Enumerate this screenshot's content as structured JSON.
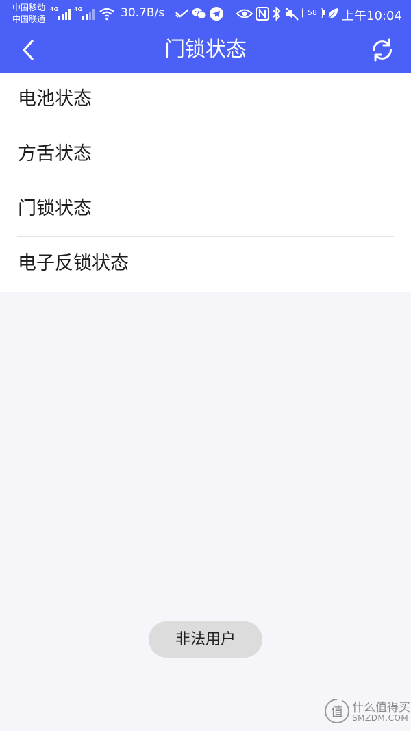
{
  "status_bar": {
    "carrier_1": "中国移动",
    "carrier_2": "中国联通",
    "network_1": "4G",
    "network_2": "4G",
    "net_speed": "30.7B/s",
    "battery": "58",
    "time": "上午10:04",
    "icons": [
      "signal-icon",
      "wifi-icon",
      "check-icon",
      "wechat-icon",
      "telegram-icon",
      "eye-icon",
      "nfc-icon",
      "bluetooth-icon",
      "mute-icon",
      "battery-icon",
      "leaf-icon"
    ]
  },
  "header": {
    "title": "门锁状态",
    "back_icon": "back-arrow-icon",
    "refresh_icon": "refresh-icon"
  },
  "menu": {
    "items": [
      {
        "label": "电池状态"
      },
      {
        "label": "方舌状态"
      },
      {
        "label": "门锁状态"
      },
      {
        "label": "电子反锁状态"
      }
    ]
  },
  "toast": {
    "message": "非法用户"
  },
  "watermark": {
    "logo_glyph": "值",
    "name": "什么值得买",
    "domain": "SMZDM.COM"
  },
  "colors": {
    "primary": "#4a60f6",
    "background": "#f6f6fa",
    "list_bg": "#ffffff",
    "toast_bg": "#dcdcdc"
  }
}
